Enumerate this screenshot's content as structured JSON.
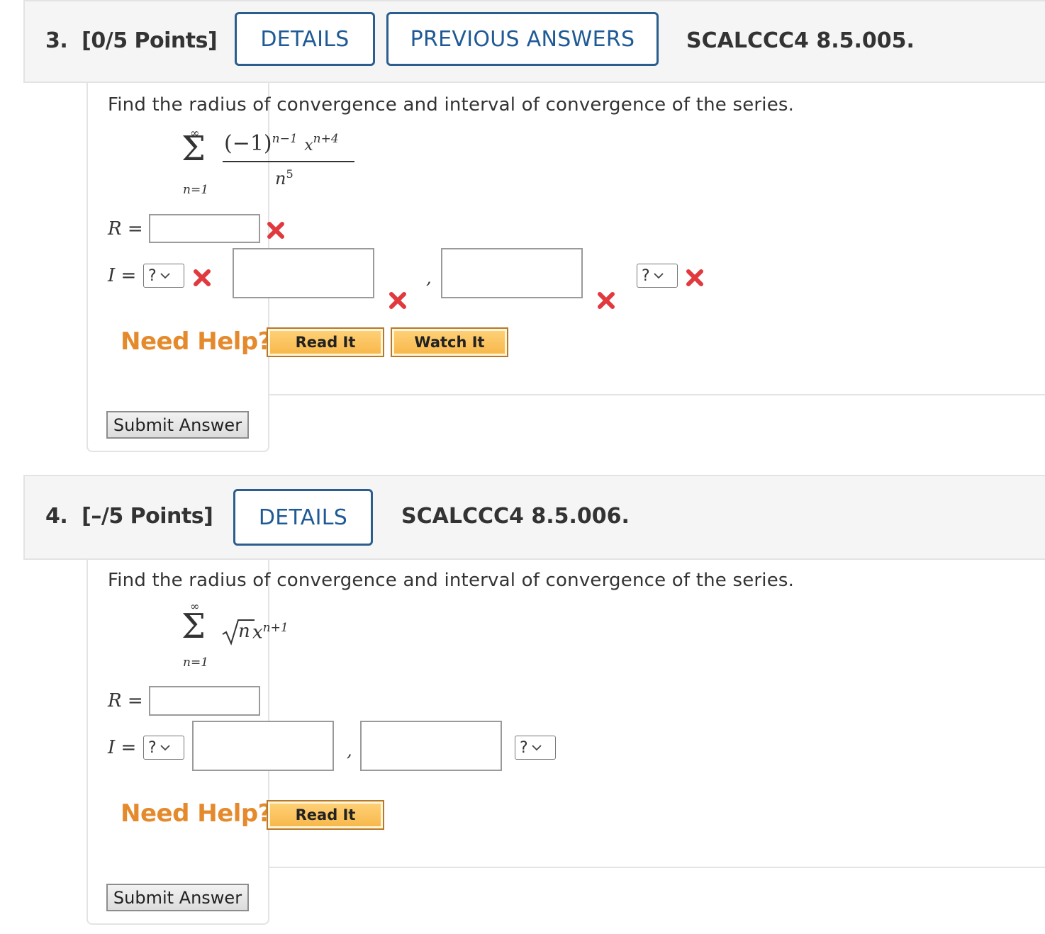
{
  "questions": [
    {
      "number": "3.",
      "points": "[0/5 Points]",
      "details_label": "DETAILS",
      "previous_answers_label": "PREVIOUS ANSWERS",
      "code": "SCALCCC4 8.5.005.",
      "prompt": "Find the radius of convergence and interval of convergence of the series.",
      "series": {
        "upper": "∞",
        "lower": "n=1",
        "numerator": "(−1)",
        "num_exp": "n−1",
        "num_x": "x",
        "num_x_exp": "n+4",
        "denominator": "n",
        "den_exp": "5"
      },
      "r_label": "R =",
      "i_label": "I =",
      "select_left": "?",
      "select_right": "?",
      "comma": ",",
      "need_help": "Need Help?",
      "read_it": "Read It",
      "watch_it": "Watch It",
      "submit": "Submit Answer"
    },
    {
      "number": "4.",
      "points": "[–/5 Points]",
      "details_label": "DETAILS",
      "code": "SCALCCC4 8.5.006.",
      "prompt": "Find the radius of convergence and interval of convergence of the series.",
      "series": {
        "upper": "∞",
        "lower": "n=1",
        "radicand": "n",
        "term": "x",
        "term_exp": "n+1"
      },
      "r_label": "R =",
      "i_label": "I =",
      "select_left": "?",
      "select_right": "?",
      "comma": ",",
      "need_help": "Need Help?",
      "read_it": "Read It",
      "submit": "Submit Answer"
    }
  ],
  "colors": {
    "accent": "#1f5a96",
    "help": "#e58a2c",
    "error": "#e0393e"
  }
}
